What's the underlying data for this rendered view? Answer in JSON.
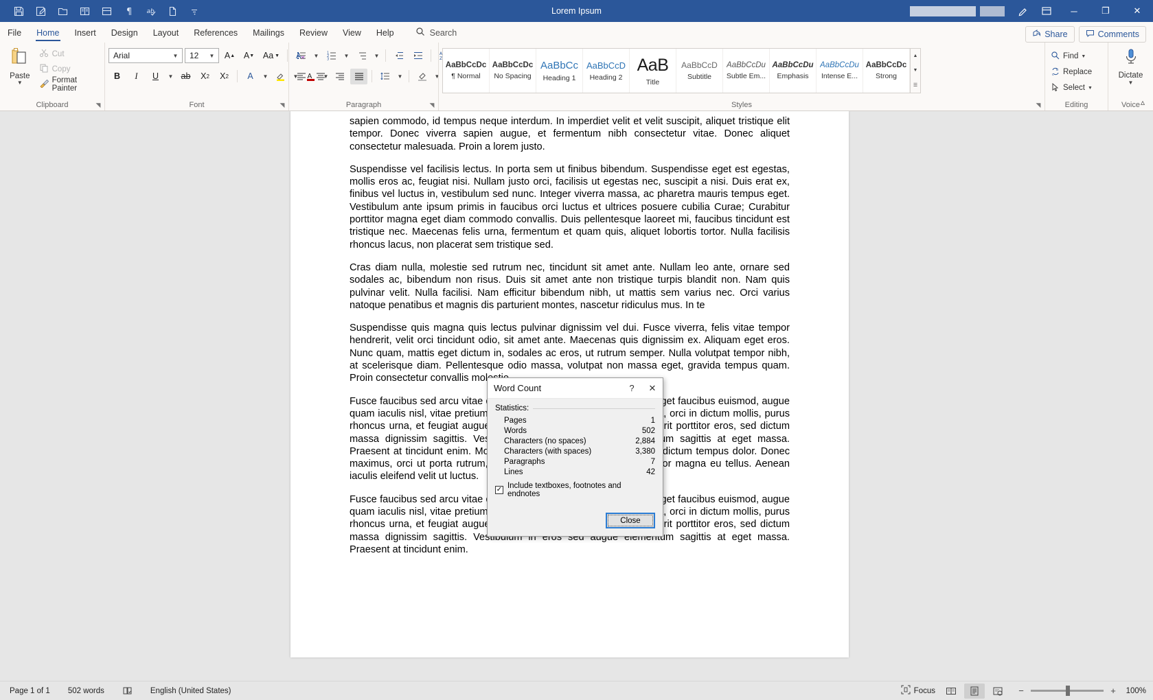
{
  "titlebar": {
    "title": "Lorem Ipsum",
    "qat": [
      {
        "name": "save-icon",
        "label": "Save"
      },
      {
        "name": "autosave-icon",
        "label": "AutoSave"
      },
      {
        "name": "open-folder-icon",
        "label": "Open"
      },
      {
        "name": "read-mode-icon",
        "label": "Read Mode"
      },
      {
        "name": "print-layout-icon",
        "label": "Print Layout"
      },
      {
        "name": "paragraph-marks-icon",
        "label": "Show/Hide"
      },
      {
        "name": "spelling-icon",
        "label": "Spelling & Grammar"
      },
      {
        "name": "new-document-icon",
        "label": "New"
      },
      {
        "name": "customize-qat-icon",
        "label": "Customize Quick Access Toolbar"
      }
    ],
    "window_buttons": {
      "minimize": "─",
      "maximize": "❐",
      "close": "✕"
    },
    "ribbon_display_icon": "ribbon-display-options-icon",
    "help_icon": "pen-icon"
  },
  "tabs": [
    {
      "label": "File",
      "active": false
    },
    {
      "label": "Home",
      "active": true
    },
    {
      "label": "Insert",
      "active": false
    },
    {
      "label": "Design",
      "active": false
    },
    {
      "label": "Layout",
      "active": false
    },
    {
      "label": "References",
      "active": false
    },
    {
      "label": "Mailings",
      "active": false
    },
    {
      "label": "Review",
      "active": false
    },
    {
      "label": "View",
      "active": false
    },
    {
      "label": "Help",
      "active": false
    }
  ],
  "search": {
    "placeholder": "Search",
    "value": "Search"
  },
  "share_button": "Share",
  "comments_button": "Comments",
  "ribbon": {
    "clipboard": {
      "group_label": "Clipboard",
      "paste_label": "Paste",
      "items": [
        {
          "label": "Cut",
          "enabled": false
        },
        {
          "label": "Copy",
          "enabled": false
        },
        {
          "label": "Format Painter",
          "enabled": true
        }
      ]
    },
    "font": {
      "group_label": "Font",
      "font_name": "Arial",
      "font_size": "12",
      "buttons": [
        "grow-font",
        "shrink-font",
        "change-case",
        "clear-formatting",
        "bold",
        "italic",
        "underline",
        "strikethrough",
        "subscript",
        "superscript",
        "text-effects",
        "text-highlight",
        "font-color"
      ]
    },
    "paragraph": {
      "group_label": "Paragraph",
      "alignment_active": "justify"
    },
    "styles": {
      "group_label": "Styles",
      "items": [
        {
          "preview": "AaBbCcDc",
          "name": "¶ Normal"
        },
        {
          "preview": "AaBbCcDc",
          "name": "No Spacing"
        },
        {
          "preview": "AaBbCс",
          "name": "Heading 1"
        },
        {
          "preview": "AaBbCcD",
          "name": "Heading 2"
        },
        {
          "preview": "AaB",
          "name": "Title"
        },
        {
          "preview": "AaBbCcD",
          "name": "Subtitle"
        },
        {
          "preview": "AaBbCcDu",
          "name": "Subtle Em..."
        },
        {
          "preview": "AaBbCcDu",
          "name": "Emphasis"
        },
        {
          "preview": "AaBbCcDu",
          "name": "Intense E..."
        },
        {
          "preview": "AaBbCcDc",
          "name": "Strong"
        }
      ]
    },
    "editing": {
      "group_label": "Editing",
      "items": [
        {
          "label": "Find",
          "icon": "search-icon"
        },
        {
          "label": "Replace",
          "icon": "replace-icon"
        },
        {
          "label": "Select",
          "icon": "cursor-icon"
        }
      ]
    },
    "voice": {
      "group_label": "Voice",
      "dictate_label": "Dictate"
    }
  },
  "document": {
    "paragraphs": [
      "sapien commodo, id tempus neque interdum. In imperdiet velit et velit suscipit, aliquet tristique elit tempor. Donec viverra sapien augue, et fermentum nibh consectetur vitae. Donec aliquet consectetur malesuada. Proin a lorem justo.",
      "Suspendisse vel facilisis lectus. In porta sem ut finibus bibendum. Suspendisse eget est egestas, mollis eros ac, feugiat nisi. Nullam justo orci, facilisis ut egestas nec, suscipit a nisi. Duis erat ex, finibus vel luctus in, vestibulum sed nunc. Integer viverra massa, ac pharetra mauris tempus eget. Vestibulum ante ipsum primis in faucibus orci luctus et ultrices posuere cubilia Curae; Curabitur porttitor magna eget diam commodo convallis. Duis pellentesque laoreet mi, faucibus tincidunt est tristique nec. Maecenas felis urna, fermentum et quam quis, aliquet lobortis tortor. Nulla facilisis rhoncus lacus, non placerat sem tristique sed.",
      "Cras diam nulla, molestie sed rutrum nec, tincidunt sit amet ante. Nullam leo ante, ornare sed sodales ac, bibendum non risus. Duis sit amet ante non tristique turpis blandit non. Nam quis pulvinar velit. Nulla facilisi. Nam efficitur bibendum nibh, ut mattis sem varius nec. Orci varius natoque penatibus et magnis dis parturient montes, nascetur ridiculus mus. In te",
      "Suspendisse quis magna quis lectus pulvinar dignissim vel dui. Fusce viverra, felis vitae tempor hendrerit, velit orci tincidunt odio, sit amet ante. Maecenas quis dignissim ex. Aliquam eget eros. Nunc quam, mattis eget dictum in, sodales ac eros, ut rutrum semper. Nulla volutpat tempor nibh, at scelerisque diam. Pellentesque odio massa, volutpat non massa eget, gravida tempus quam. Proin consectetur convallis molestie.",
      "Fusce faucibus sed arcu vitae dictum. Suspendisse molestie, augue eget faucibus euismod, augue quam iaculis nisl, vitae pretium risus lorem ac massa. Vivamus lacinia, orci in dictum mollis, purus rhoncus urna, et feugiat augue ligula lacinia ex. Pellentesque hendrerit porttitor eros, sed dictum massa dignissim sagittis. Vestibulum in eros sed augue elementum sagittis at eget massa. Praesent at tincidunt enim. Morbi tellus neque, lacinia et diam vitae, dictum tempus dolor. Donec maximus, orci ut porta rutrum, mi metus feugiat felis, in sodales tortor magna eu tellus. Aenean iaculis eleifend velit ut luctus.",
      "Fusce faucibus sed arcu vitae dictum. Suspendisse molestie, augue eget faucibus euismod, augue quam iaculis nisl, vitae pretium risus lorem ac massa. Vivamus lacinia, orci in dictum mollis, purus rhoncus urna, et feugiat augue ligula lacinia ex. Pellentesque hendrerit porttitor eros, sed dictum massa dignissim sagittis. Vestibulum in eros sed augue elementum sagittis at eget massa. Praesent at tincidunt enim."
    ]
  },
  "word_count_dialog": {
    "title": "Word Count",
    "help_button": "?",
    "close_button": "✕",
    "statistics_label": "Statistics:",
    "rows": [
      {
        "label": "Pages",
        "value": "1"
      },
      {
        "label": "Words",
        "value": "502"
      },
      {
        "label": "Characters (no spaces)",
        "value": "2,884"
      },
      {
        "label": "Characters (with spaces)",
        "value": "3,380"
      },
      {
        "label": "Paragraphs",
        "value": "7"
      },
      {
        "label": "Lines",
        "value": "42"
      }
    ],
    "checkbox_label": "Include textboxes, footnotes and endnotes",
    "checkbox_checked": true,
    "close_label": "Close"
  },
  "statusbar": {
    "page_info": "Page 1 of 1",
    "word_count": "502 words",
    "proofing_icon": "proofing-errors-icon",
    "language": "English (United States)",
    "focus_label": "Focus",
    "views": [
      {
        "name": "read-mode-view",
        "active": false
      },
      {
        "name": "print-layout-view",
        "active": true
      },
      {
        "name": "web-layout-view",
        "active": false
      }
    ],
    "zoom_out": "−",
    "zoom_in": "+",
    "zoom_level": "100%"
  },
  "colors": {
    "brand": "#2b579a",
    "ribbon_bg": "#fbf9f7",
    "canvas": "#e6e6e6"
  }
}
